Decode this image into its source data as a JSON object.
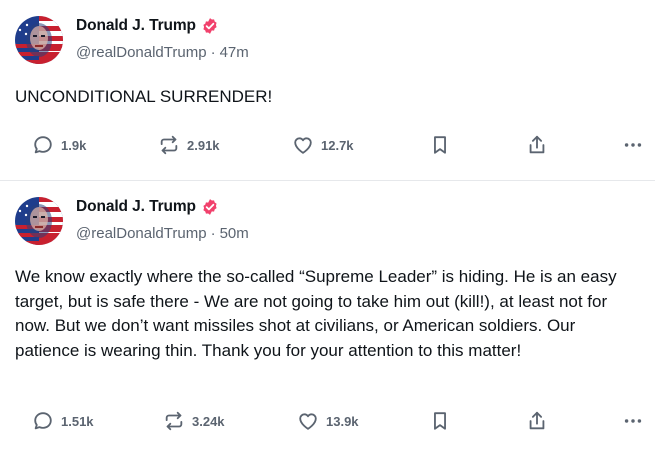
{
  "posts": [
    {
      "author": {
        "display_name": "Donald J. Trump",
        "handle": "@realDonaldTrump",
        "verified": true
      },
      "timestamp": "47m",
      "text": "UNCONDITIONAL SURRENDER!",
      "actions": {
        "replies": "1.9k",
        "reposts": "2.91k",
        "likes": "12.7k",
        "reply_icon": "reply-icon",
        "repost_icon": "repost-icon",
        "like_icon": "heart-icon",
        "bookmark_icon": "bookmark-icon",
        "share_icon": "share-icon",
        "more_icon": "more-icon"
      }
    },
    {
      "author": {
        "display_name": "Donald J. Trump",
        "handle": "@realDonaldTrump",
        "verified": true
      },
      "timestamp": "50m",
      "text": "We know exactly where the so-called “Supreme Leader” is hiding. He is an easy target, but is safe there - We are not going to take him out (kill!), at least not for now. But we don’t want missiles shot at civilians, or American soldiers. Our patience is wearing thin. Thank you for your attention to this matter!",
      "actions": {
        "replies": "1.51k",
        "reposts": "3.24k",
        "likes": "13.9k",
        "reply_icon": "reply-icon",
        "repost_icon": "repost-icon",
        "like_icon": "heart-icon",
        "bookmark_icon": "bookmark-icon",
        "share_icon": "share-icon",
        "more_icon": "more-icon"
      }
    }
  ],
  "colors": {
    "text_primary": "#0f1419",
    "text_secondary": "#5b6470",
    "verified_badge": "#f1416c",
    "divider": "#e6e8eb"
  },
  "separator": "·"
}
